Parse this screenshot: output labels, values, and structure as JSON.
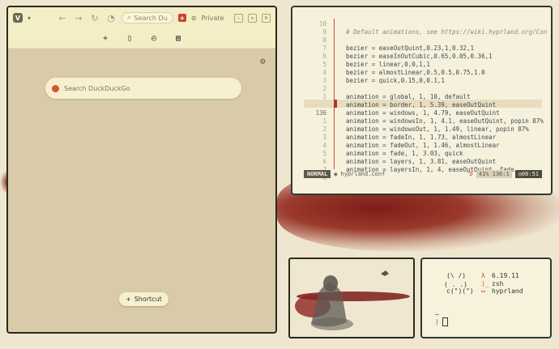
{
  "browser": {
    "address_placeholder": "Search Du",
    "private_label": "Private",
    "search_placeholder": "Search DuckDuckGo",
    "shortcut_label": "Shortcut"
  },
  "editor": {
    "gutter": [
      "10",
      "9",
      "8",
      "7",
      "6",
      "5",
      "4",
      "3",
      "2",
      "1",
      "",
      "136",
      "1",
      "2",
      "3",
      "4",
      "5",
      "6",
      "7",
      "8"
    ],
    "lines": [
      "",
      "# Default animations, see https://wiki.hyprland.org/Con",
      "",
      "bezier = easeOutQuint,0.23,1,0.32,1",
      "bezier = easeInOutCubic,0.65,0.05,0.36,1",
      "bezier = linear,0,0,1,1",
      "bezier = almostLinear,0.5,0.5,0.75,1.0",
      "bezier = quick,0.15,0,0.1,1",
      "",
      "animation = global, 1, 10, default",
      "animation = border, 1, 5.39, easeOutQuint",
      "animation = windows, 1, 4.79, easeOutQuint",
      "animation = windowsIn, 1, 4.1, easeOutQuint, popin 87%",
      "animation = windowsOut, 1, 1.49, linear, popin 87%",
      "animation = fadeIn, 1, 1.73, almostLinear",
      "animation = fadeOut, 1, 1.46, almostLinear",
      "animation = fade, 1, 3.03, quick",
      "animation = layers, 1, 3.81, easeOutQuint",
      "animation = layersIn, 1, 4, easeOutQuint, fade"
    ],
    "status": {
      "mode": "NORMAL",
      "file": "hyprland.conf",
      "flag": "^D",
      "pos": "41%  136:1",
      "time": "08:51"
    }
  },
  "terminal": {
    "art": [
      "(\\ /)",
      "( . .)",
      "c(\")(\")"
    ],
    "info": [
      "6.19.11",
      "zsh",
      "hyprland"
    ],
    "prompt": "~",
    "prompt_symbol": ")"
  },
  "colors": {
    "accent": "#cc4a3b",
    "brush": "#7e1d18"
  }
}
